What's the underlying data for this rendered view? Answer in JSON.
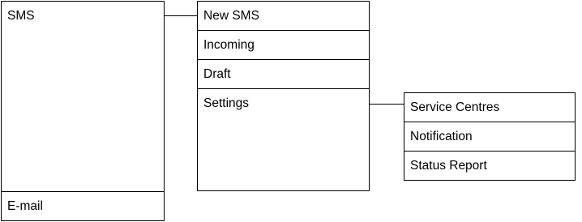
{
  "menu_tree": {
    "root": {
      "items": [
        {
          "label": "SMS"
        },
        {
          "label": "E-mail"
        }
      ]
    },
    "sms_menu": {
      "items": [
        {
          "label": "New SMS"
        },
        {
          "label": "Incoming"
        },
        {
          "label": "Draft"
        },
        {
          "label": "Settings"
        }
      ]
    },
    "settings_menu": {
      "items": [
        {
          "label": "Service Centres"
        },
        {
          "label": "Notification"
        },
        {
          "label": "Status Report"
        }
      ]
    }
  }
}
